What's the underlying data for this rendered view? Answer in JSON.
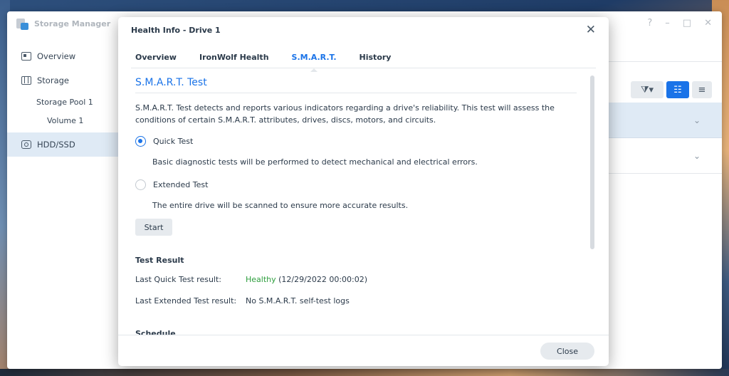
{
  "app": {
    "title": "Storage Manager"
  },
  "window_controls": {
    "help": "?",
    "minimize": "–",
    "maximize": "□",
    "close": "✕"
  },
  "sidebar": {
    "items": [
      {
        "label": "Overview"
      },
      {
        "label": "Storage"
      },
      {
        "label": "Storage Pool 1"
      },
      {
        "label": "Volume 1"
      },
      {
        "label": "HDD/SSD"
      }
    ]
  },
  "dialog": {
    "title": "Health Info - Drive 1",
    "close_icon": "✕",
    "tabs": [
      {
        "label": "Overview"
      },
      {
        "label": "IronWolf Health"
      },
      {
        "label": "S.M.A.R.T."
      },
      {
        "label": "History"
      }
    ],
    "active_tab": "S.M.A.R.T.",
    "smart_test": {
      "heading": "S.M.A.R.T. Test",
      "description": "S.M.A.R.T. Test detects and reports various indicators regarding a drive's reliability. This test will assess the conditions of certain S.M.A.R.T. attributes, drives, discs, motors, and circuits.",
      "options": [
        {
          "label": "Quick Test",
          "desc": "Basic diagnostic tests will be performed to detect mechanical and electrical errors.",
          "selected": true
        },
        {
          "label": "Extended Test",
          "desc": "The entire drive will be scanned to ensure more accurate results.",
          "selected": false
        }
      ],
      "start_label": "Start"
    },
    "test_result": {
      "heading": "Test Result",
      "quick_label": "Last Quick Test result:",
      "quick_status": "Healthy",
      "quick_time": "(12/29/2022 00:00:02)",
      "extended_label": "Last Extended Test result:",
      "extended_value": "No S.M.A.R.T. self-test logs"
    },
    "schedule": {
      "heading": "Schedule"
    },
    "close_label": "Close"
  },
  "colors": {
    "accent": "#1a73e8",
    "healthy": "#2e9e3e"
  }
}
